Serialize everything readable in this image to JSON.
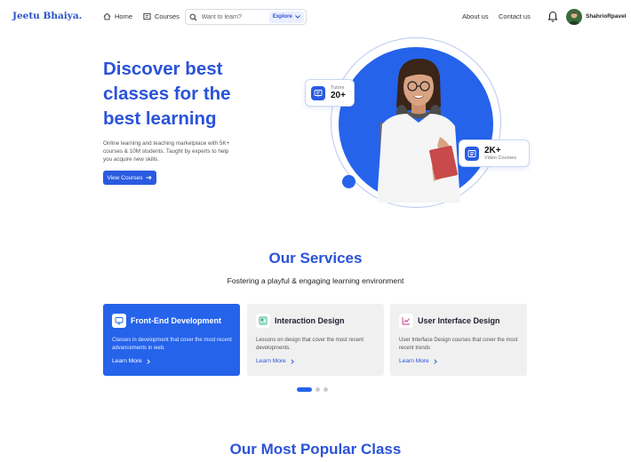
{
  "header": {
    "logo": "Jeetu Bhaiya.",
    "nav": {
      "home": "Home",
      "courses": "Courses",
      "about": "About us",
      "contact": "Contact us"
    },
    "search": {
      "placeholder": "Want to learn?",
      "explore_label": "Explore"
    },
    "user": {
      "name": "ShahrioRpavel"
    },
    "icons": {
      "home": "home-icon",
      "courses": "book-icon",
      "search": "search-icon",
      "explore": "chevron-down-icon",
      "bell": "bell-icon"
    }
  },
  "hero": {
    "title_lines": [
      "Discover best",
      "classes for the",
      "best learning"
    ],
    "description": "Online learning and teaching marketplace with 5K+ courses & 10M students. Taught by experts to help you acquire new skills.",
    "cta_label": "View Courses",
    "tutors": {
      "label": "Tutors",
      "value": "20+"
    },
    "courses": {
      "value": "2K+",
      "label": "Video Courses"
    }
  },
  "services": {
    "title": "Our Services",
    "subtitle": "Fostering a playful & engaging learning environment",
    "cards": [
      {
        "title": "Front-End Development",
        "description": "Classes in development that cover the most recent advancements in web.",
        "link": "Learn More",
        "active": true
      },
      {
        "title": "Interaction Design",
        "description": "Lessons on design that cover the most recent developments.",
        "link": "Learn More",
        "active": false
      },
      {
        "title": "User Interface Design",
        "description": "User Interface Design courses that cover the most recent  trends",
        "link": "Learn More",
        "active": false
      }
    ],
    "pager": {
      "count": 3,
      "current": 1
    }
  },
  "popular": {
    "title": "Our Most Popular Class"
  },
  "colors": {
    "brand": "#2563eb",
    "heading": "#2a53d9",
    "card_bg": "#f0f0f1"
  }
}
